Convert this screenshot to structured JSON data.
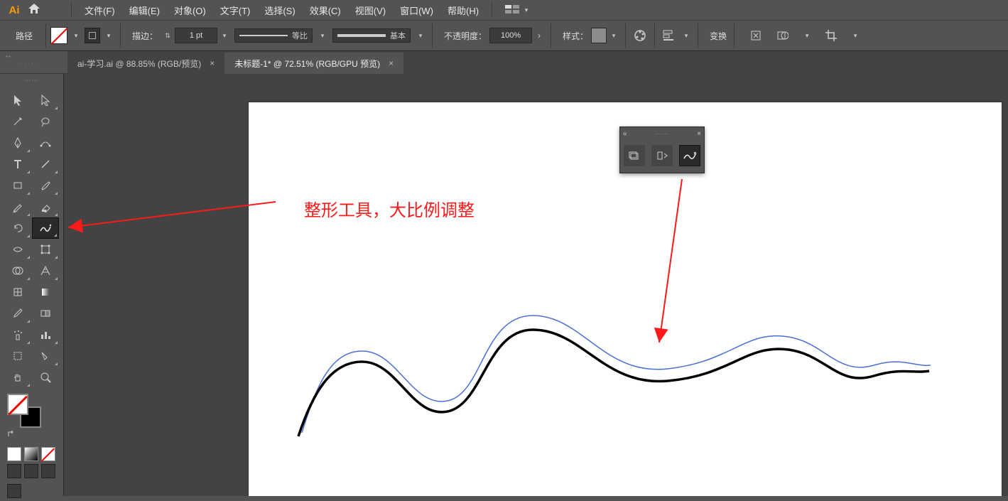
{
  "menu": {
    "logo": "Ai",
    "items": [
      "文件(F)",
      "编辑(E)",
      "对象(O)",
      "文字(T)",
      "选择(S)",
      "效果(C)",
      "视图(V)",
      "窗口(W)",
      "帮助(H)"
    ]
  },
  "controlbar": {
    "context_label": "路径",
    "stroke_label": "描边：",
    "stroke_value": "1 pt",
    "preset1_label": "等比",
    "preset2_label": "基本",
    "opacity_label": "不透明度：",
    "opacity_value": "100%",
    "style_label": "样式：",
    "transform_label": "变换"
  },
  "tabs": [
    {
      "title": "ai-学习.ai @ 88.85% (RGB/预览)"
    },
    {
      "title": "未标题-1* @ 72.51% (RGB/GPU 预览)"
    }
  ],
  "annotation": {
    "text": "整形工具，大比例调整"
  },
  "panel": {
    "buttons": [
      "layers",
      "align",
      "reshape"
    ]
  },
  "toolbox_header": "······"
}
